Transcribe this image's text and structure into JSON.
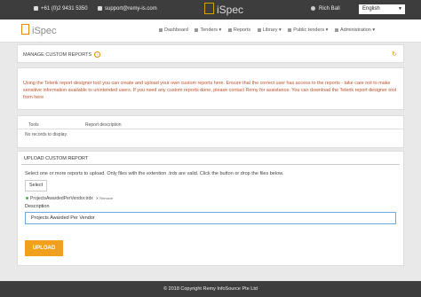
{
  "topbar": {
    "phone": "+61 (0)2 9431 5350",
    "email": "support@remy-is.com",
    "brand": "iSpec",
    "user": "Rich Ball",
    "language": "English"
  },
  "navbar": {
    "logo": "iSpec",
    "items": [
      "Dashboard",
      "Tenders ▾",
      "Reports",
      "Library ▾",
      "Public tenders ▾",
      "Administration ▾"
    ]
  },
  "page": {
    "title": "MANAGE CUSTOM REPORTS",
    "message": "Using the Telerik report designer tool you can create and upload your own custom reports here. Ensure that the correct user has access to the reports - take care not to make sensitive information available to unintended users. If you need any custom reports done, please contact Remy for assistance. You can download the Telerik report designer tool from",
    "message_link": "here"
  },
  "table": {
    "col_tools": "Tools",
    "col_desc": "Report description",
    "empty": "No records to display."
  },
  "upload": {
    "title": "UPLOAD CUSTOM REPORT",
    "instruction": "Select one or more reports to upload. Only files with the extention .trdx are valid. Click the button or drop the files below.",
    "select_label": "Select",
    "file_name": "ProjectsAwardedPerVendor.trdx",
    "remove_label": "Remove",
    "desc_label": "Description",
    "desc_value": "Projects Awarded Per Vendor",
    "upload_label": "UPLOAD"
  },
  "footer": {
    "text": "© 2018 Copyright  Remy InfoSource Pte Ltd"
  },
  "colors": {
    "accent": "#f0a01d",
    "message": "#c0522b",
    "topbar": "#3d3d3d"
  }
}
